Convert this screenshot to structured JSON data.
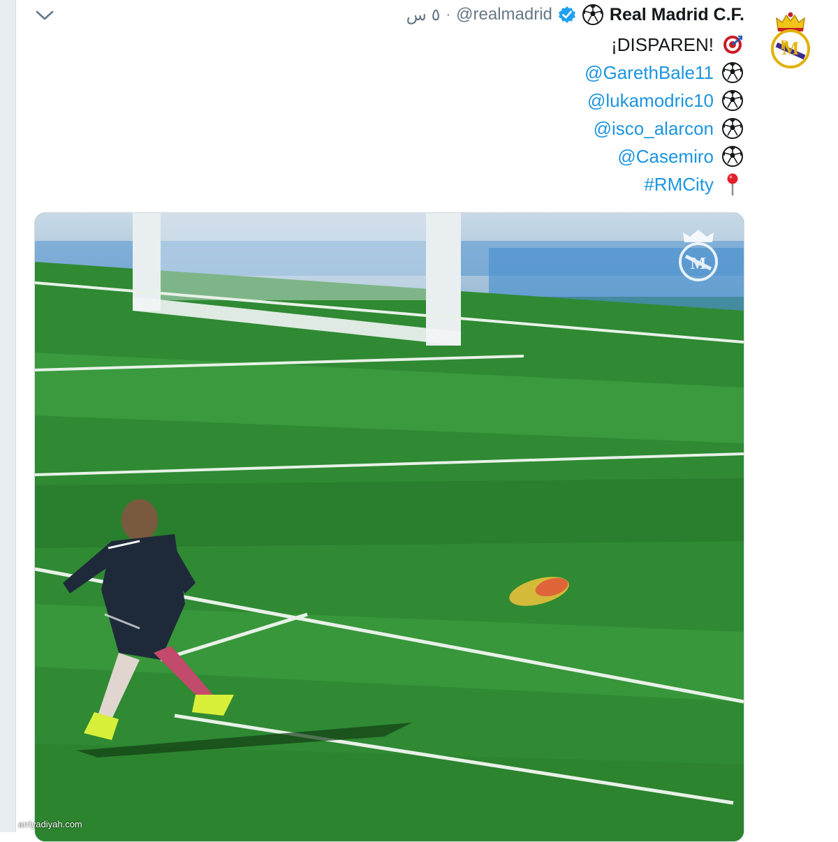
{
  "tweet": {
    "display_name": "Real Madrid C.F.",
    "handle": "@realmadrid",
    "time": "٥ س",
    "separator": "·",
    "lines": [
      {
        "icon": "target-icon",
        "text": "¡DISPAREN!",
        "is_link": false
      },
      {
        "icon": "soccer-ball-icon",
        "text": "@GarethBale11",
        "is_link": true
      },
      {
        "icon": "soccer-ball-icon",
        "text": "@lukamodric10",
        "is_link": true
      },
      {
        "icon": "soccer-ball-icon",
        "text": "@isco_alarcon",
        "is_link": true
      },
      {
        "icon": "soccer-ball-icon",
        "text": "@Casemiro",
        "is_link": true
      },
      {
        "icon": "round-pushpin-icon",
        "text": "#RMCity",
        "is_link": true
      }
    ]
  },
  "media": {
    "watermark": "arriyadiyah.com"
  },
  "colors": {
    "link": "#1b95e0",
    "verified": "#1da1f2",
    "pitch": "#2f8a33"
  }
}
